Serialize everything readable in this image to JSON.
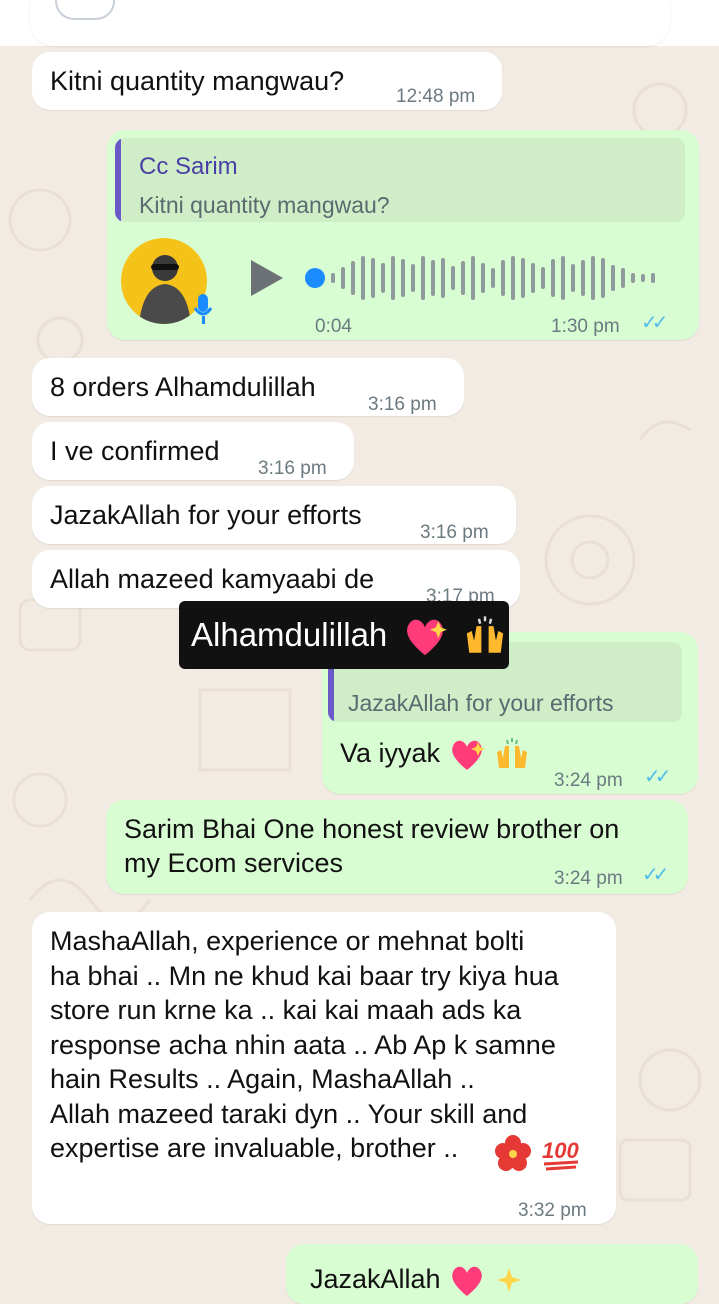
{
  "messages": {
    "m1": {
      "text": "Kitni quantity mangwau?",
      "time": "12:48 pm"
    },
    "voice": {
      "quote_name": "Cc Sarim",
      "quote_text": "Kitni quantity mangwau?",
      "duration": "0:04",
      "time": "1:30 pm",
      "progress": 0.0
    },
    "m2": {
      "text": "8 orders Alhamdulillah",
      "time": "3:16 pm"
    },
    "m3": {
      "text": "I ve confirmed",
      "time": "3:16 pm"
    },
    "m4": {
      "text": "JazakAllah for your efforts",
      "time": "3:16 pm"
    },
    "m5": {
      "text": "Allah mazeed kamyaabi de",
      "time": "3:17 pm"
    },
    "m6": {
      "quote_text": "JazakAllah for your efforts",
      "text": "Va iyyak",
      "time": "3:24 pm"
    },
    "m7": {
      "line1": "Sarim Bhai One honest review brother on",
      "line2": "my Ecom services",
      "time": "3:24 pm"
    },
    "m8": {
      "lines": [
        "MashaAllah, experience or mehnat bolti",
        "ha bhai .. Mn ne khud kai baar try kiya hua",
        "store run krne ka .. kai kai maah ads ka",
        "response acha nhin aata .. Ab Ap k samne",
        "hain Results .. Again, MashaAllah ..",
        "Allah mazeed taraki dyn .. Your skill and",
        "expertise are invaluable, brother .."
      ],
      "time": "3:32 pm"
    },
    "m9": {
      "text": "JazakAllah"
    }
  },
  "caption": {
    "text": "Alhamdulillah"
  },
  "icons": {
    "heart": "sparkling-heart",
    "hands": "raising-hands",
    "flower": "hibiscus",
    "hundred": "hundred-points"
  },
  "colors": {
    "incoming": "#ffffff",
    "outgoing": "#d9fdd3",
    "ticks": "#53bdeb",
    "voice_accent": "#1a8cff"
  }
}
